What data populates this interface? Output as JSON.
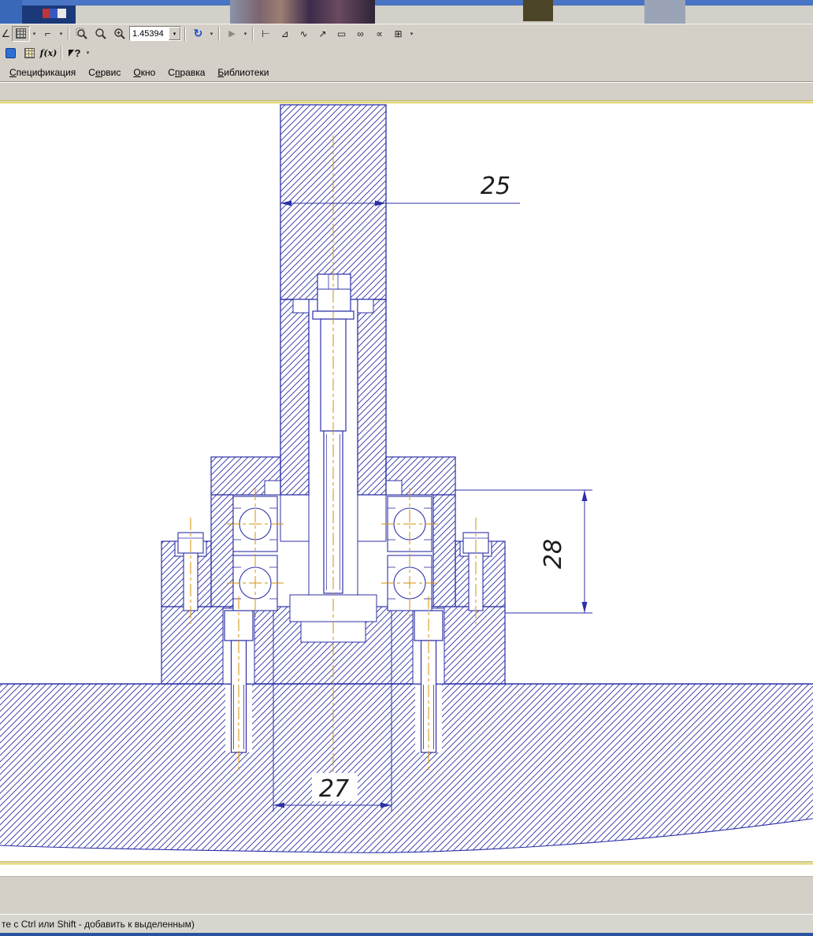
{
  "ui": {
    "dropdown_glyph": "▾",
    "overflow_glyph": "▾"
  },
  "toolbar1": {
    "corner_tool_glyph": "∠",
    "ortho_glyph": "⌐",
    "refresh_glyph": "↻",
    "select_arrow_glyph": "▶",
    "zoom_scale_value": "1.45394",
    "measure_icons": [
      {
        "name": "measure-distance-icon",
        "glyph": "⊢"
      },
      {
        "name": "measure-angle-icon",
        "glyph": "⊿"
      },
      {
        "name": "measure-curve-icon",
        "glyph": "∿"
      },
      {
        "name": "measure-node-icon",
        "glyph": "↗"
      },
      {
        "name": "measure-area-icon",
        "glyph": "▭"
      },
      {
        "name": "find-icon",
        "glyph": "∞"
      },
      {
        "name": "find-in-doc-icon",
        "glyph": "∝"
      },
      {
        "name": "report-table-icon",
        "glyph": "⊞"
      }
    ]
  },
  "toolbar2": {
    "fx_label": "f(x)",
    "help_glyph": "?"
  },
  "menubar": {
    "items": [
      {
        "id": "menu-item-specification",
        "pre": "",
        "accel": "С",
        "rest": "пецификация"
      },
      {
        "id": "menu-item-service",
        "pre": "С",
        "accel": "е",
        "rest": "рвис"
      },
      {
        "id": "menu-item-window",
        "pre": "",
        "accel": "О",
        "rest": "кно"
      },
      {
        "id": "menu-item-help",
        "pre": "С",
        "accel": "п",
        "rest": "равка"
      },
      {
        "id": "menu-item-libraries",
        "pre": "",
        "accel": "Б",
        "rest": "иблиотеки"
      }
    ]
  },
  "drawing": {
    "dimensions": {
      "width_top": "25",
      "height_right": "28",
      "width_bottom": "27"
    },
    "colors": {
      "ink": "#2d31a6",
      "centerline": "#d4920a",
      "sheet_border": "#9a8700",
      "dim_text": "#1c1c1c"
    }
  },
  "statusbar": {
    "message": "те с Ctrl или Shift - добавить к выделенным)"
  }
}
